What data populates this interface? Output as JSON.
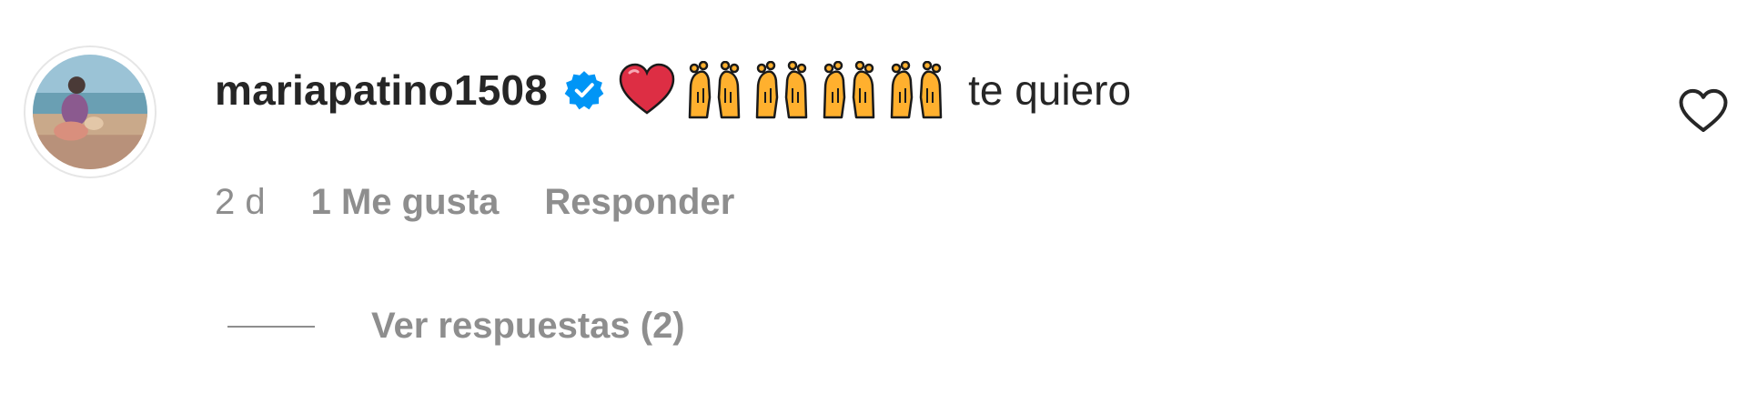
{
  "comment": {
    "avatar_icon": "profile-photo-beach",
    "username": "mariapatino1508",
    "verified_icon": "verified-badge-icon",
    "verified_color": "#0095f6",
    "emojis": [
      "red-heart-emoji",
      "raising-hands-emoji",
      "raising-hands-emoji",
      "raising-hands-emoji",
      "raising-hands-emoji"
    ],
    "text": "te quiero",
    "like_icon": "heart-outline-icon",
    "time": "2 d",
    "likes": "1 Me gusta",
    "reply": "Responder",
    "view_replies": "Ver respuestas (2)"
  }
}
